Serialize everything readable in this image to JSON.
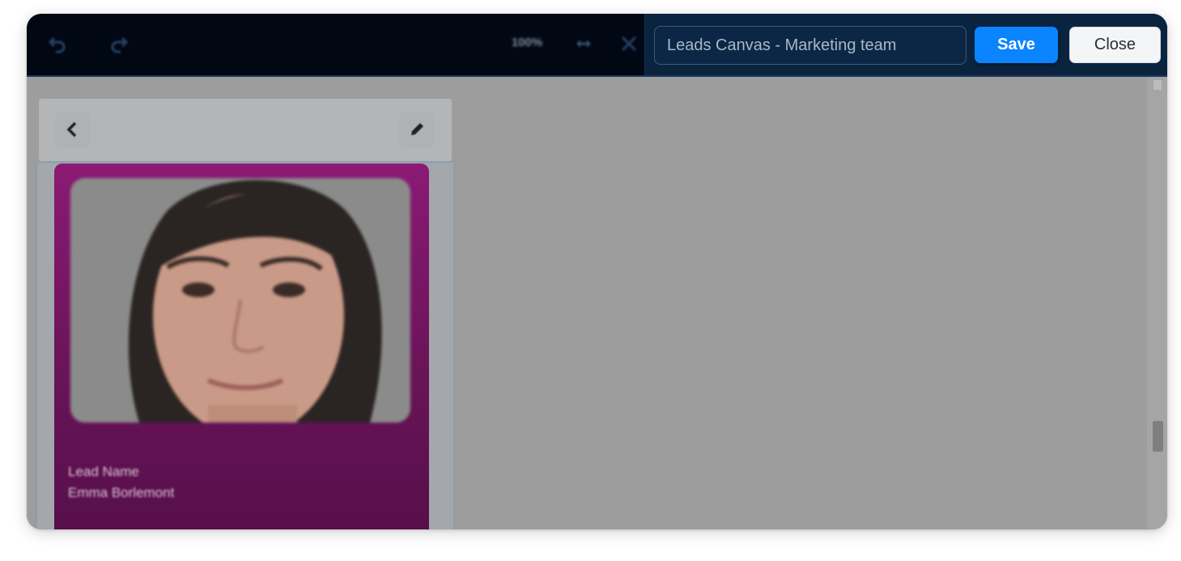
{
  "toolbar": {
    "undo_icon": "undo-icon",
    "redo_icon": "redo-icon",
    "zoom_level": "100%",
    "fit_icon": "arrows-horizontal-icon",
    "fullscreen_icon": "expand-icon"
  },
  "title_panel": {
    "canvas_name": "Leads Canvas - Marketing team",
    "save_label": "Save",
    "close_label": "Close"
  },
  "card_editor": {
    "back_icon": "chevron-left-icon",
    "edit_icon": "pencil-icon",
    "field_label": "Lead Name",
    "field_value": "Emma Borlemont"
  },
  "colors": {
    "toolbar_bg": "#010713",
    "panel_bg": "#0a2440",
    "save_accent": "#0a84ff",
    "card_bg": "#6a1459",
    "canvas_bg": "#9d9d9d"
  }
}
